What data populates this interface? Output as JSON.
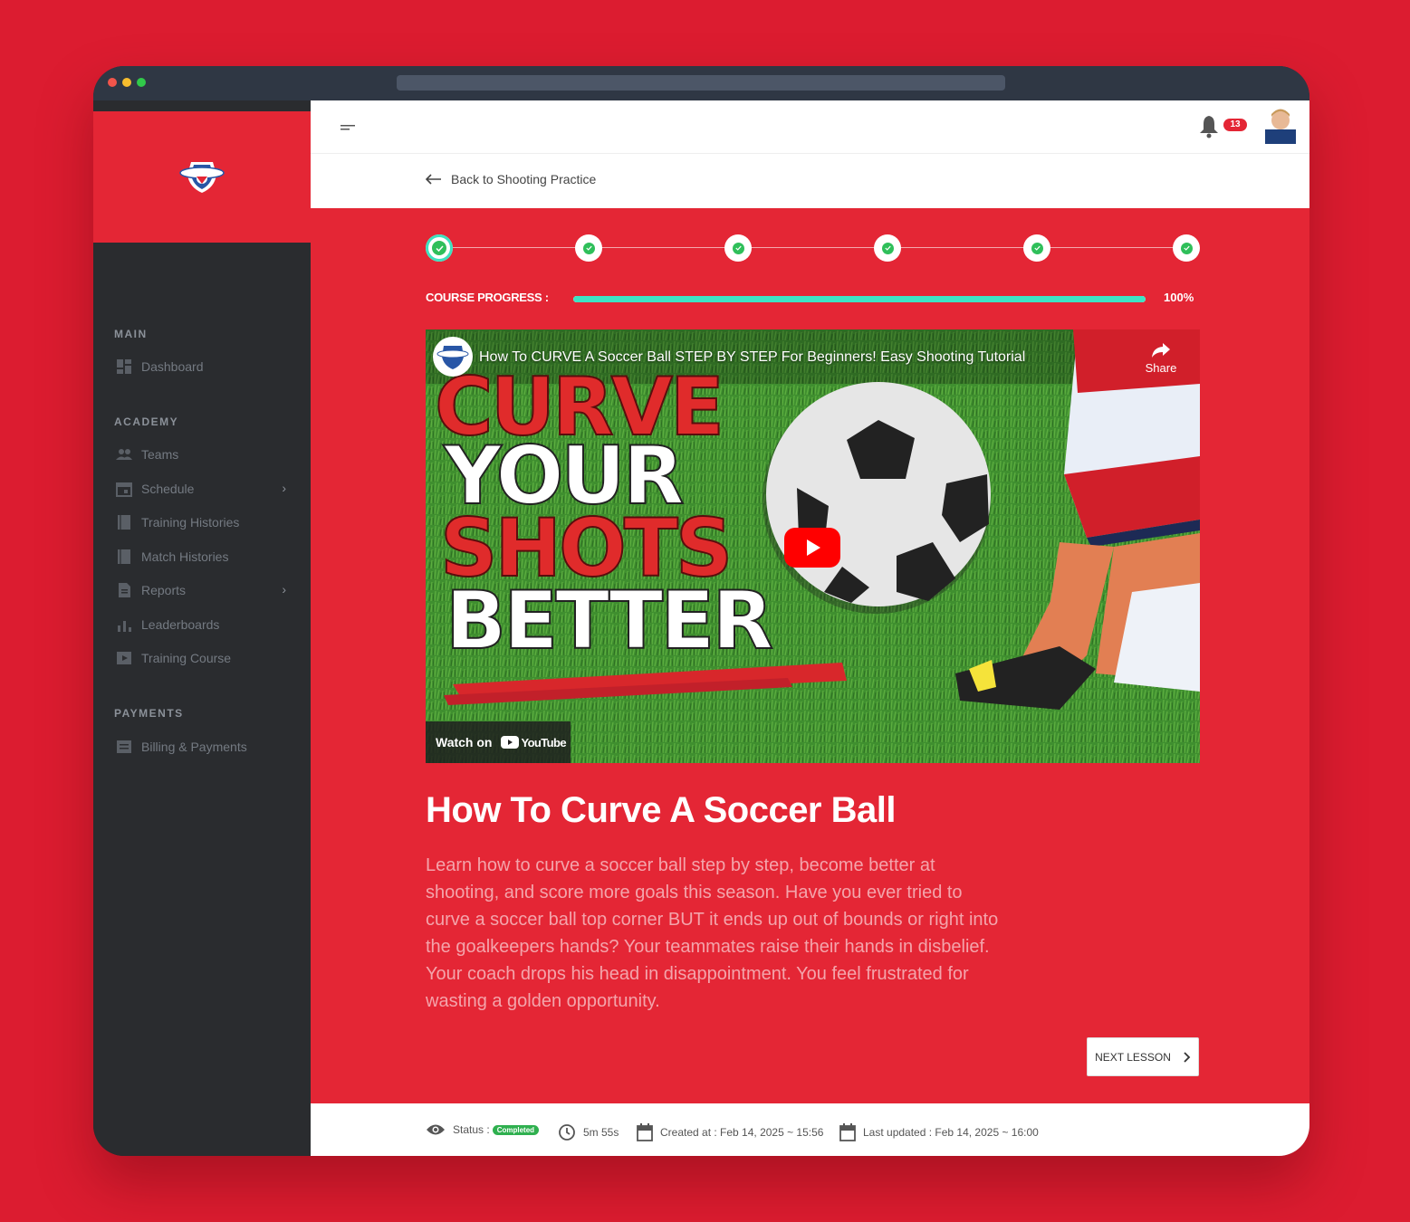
{
  "window": {
    "url": ""
  },
  "sidebar": {
    "sections": [
      {
        "label": "MAIN"
      },
      {
        "label": "ACADEMY"
      },
      {
        "label": "PAYMENTS"
      }
    ],
    "items": [
      {
        "label": "Dashboard",
        "icon": "dashboard-icon"
      },
      {
        "label": "Teams",
        "icon": "teams-icon"
      },
      {
        "label": "Schedule",
        "icon": "calendar-icon",
        "has_submenu": true
      },
      {
        "label": "Training Histories",
        "icon": "book-icon"
      },
      {
        "label": "Match Histories",
        "icon": "book-icon"
      },
      {
        "label": "Reports",
        "icon": "document-icon",
        "has_submenu": true
      },
      {
        "label": "Leaderboards",
        "icon": "bar-chart-icon"
      },
      {
        "label": "Training Course",
        "icon": "video-icon"
      },
      {
        "label": "Billing & Payments",
        "icon": "billing-icon"
      }
    ]
  },
  "header": {
    "notification_count": "13"
  },
  "back": {
    "label": "Back to Shooting Practice"
  },
  "course": {
    "steps_completed": 6,
    "steps_total": 6,
    "progress_label": "COURSE PROGRESS :",
    "progress_value": 1.0,
    "progress_text": "100%"
  },
  "video": {
    "title": "How To CURVE A Soccer Ball STEP BY STEP For Beginners! Easy Shooting Tutorial",
    "share_label": "Share",
    "watch_on_label": "Watch on",
    "youtube_label": "YouTube",
    "thumbnail_words": [
      "CURVE",
      "YOUR",
      "SHOTS",
      "BETTER"
    ]
  },
  "lesson": {
    "title": "How To Curve A Soccer Ball",
    "description": "Learn how to curve a soccer ball step by step, become better at shooting, and score more goals this season. Have you ever tried to curve a soccer ball top corner BUT it ends up out of bounds or right into the goalkeepers hands? Your teammates raise their hands in disbelief. Your coach drops his head in disappointment. You feel frustrated for wasting a golden opportunity.",
    "next_label": "NEXT LESSON"
  },
  "footer": {
    "status_label": "Status :",
    "status_value": "Completed",
    "duration": "5m 55s",
    "created": "Created at : Feb 14, 2025 ~ 15:56",
    "updated": "Last updated : Feb 14, 2025 ~ 16:00"
  },
  "colors": {
    "brand_red": "#e42635",
    "accent_teal": "#3de3c4",
    "success_green": "#2fbf5a",
    "sidebar_bg": "#2a2c2f"
  }
}
